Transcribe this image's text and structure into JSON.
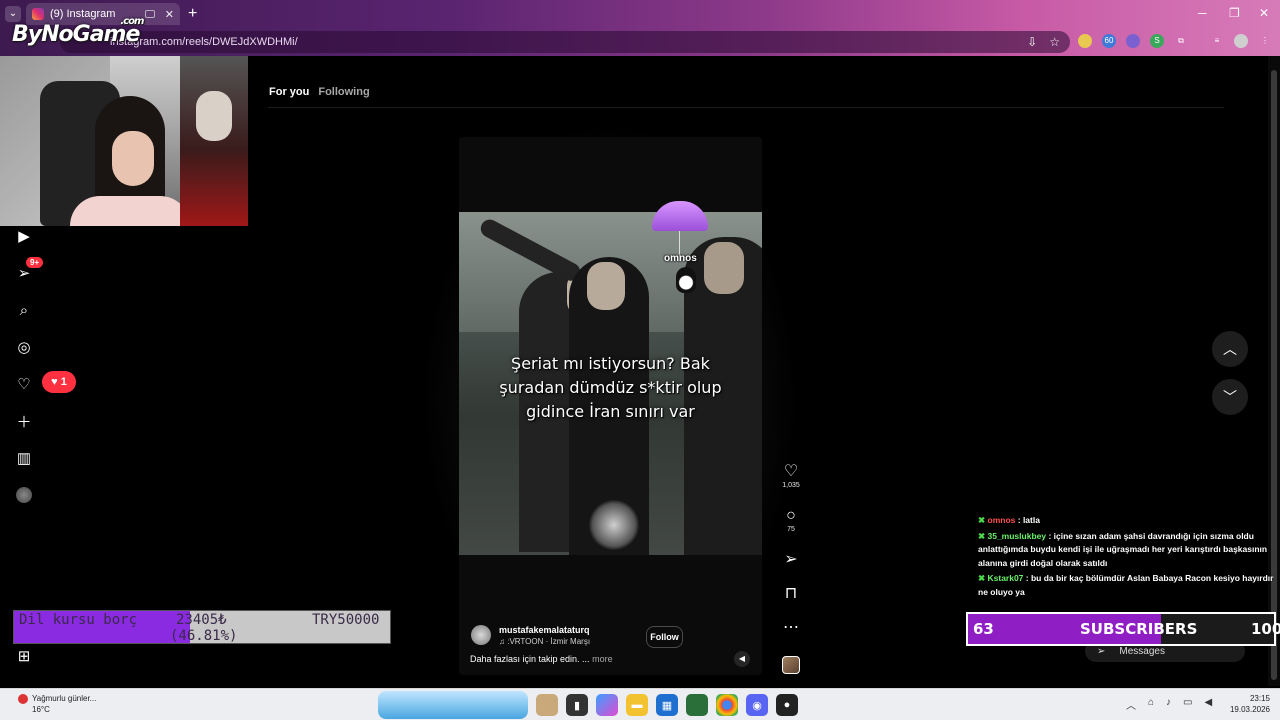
{
  "browser": {
    "tab_title": "(9) Instagram",
    "url": "instagram.com/reels/DWEJdXWDHMi/",
    "new_tab": "+",
    "brand_logo": "ByNoGame",
    "brand_suffix": ".com",
    "ext_badge": "60"
  },
  "sidebar": {
    "reels_badge": "9+",
    "notifications_count": "1"
  },
  "feed": {
    "tabs": [
      {
        "label": "For you",
        "active": true
      },
      {
        "label": "Following",
        "active": false
      }
    ]
  },
  "reel": {
    "overlay_caption": "Şeriat mı istiyorsun? Bak şuradan dümdüz s*ktir olup gidince İran sınırı var",
    "drop_username": "omnos",
    "author": "mustafakemalataturq",
    "audio": "♫ :VRTOON · İzmir Marşı",
    "follow_label": "Follow",
    "description": "Daha fazlası için takip edin. ...",
    "more_label": "more",
    "likes": "1,035",
    "comments": "75",
    "mute_icon": "speaker-icon"
  },
  "goal": {
    "label": "Dil kursu borç",
    "current": "23405₺",
    "target": "TRY50000",
    "percent_text": "(46.81%)",
    "percent": 46.81
  },
  "chat": [
    {
      "user": "omnos",
      "message": "latla",
      "color": "#ff5050"
    },
    {
      "user": "35_muslukbey",
      "message": "içine sızan adam şahsi davrandığı için sızma oldu anlattığımda buydu kendi işi ile uğraşmadı her yeri karıştırdı başkasının alanına girdi doğal olarak satıldı",
      "color": "#6cf06c"
    },
    {
      "user": "Kstark07",
      "message": "bu da bir kaç bölümdür Aslan Babaya Racon kesiyo hayırdır ne oluyo ya",
      "color": "#6cf06c"
    }
  ],
  "subscribers": {
    "current": "63",
    "label": "SUBSCRIBERS",
    "goal": "100",
    "fraction": 0.63
  },
  "messages_label": "Messages",
  "taskbar": {
    "weather_title": "Yağmurlu günler...",
    "weather_temp": "16°C",
    "time": "23:15",
    "date": "19.03.2026"
  }
}
